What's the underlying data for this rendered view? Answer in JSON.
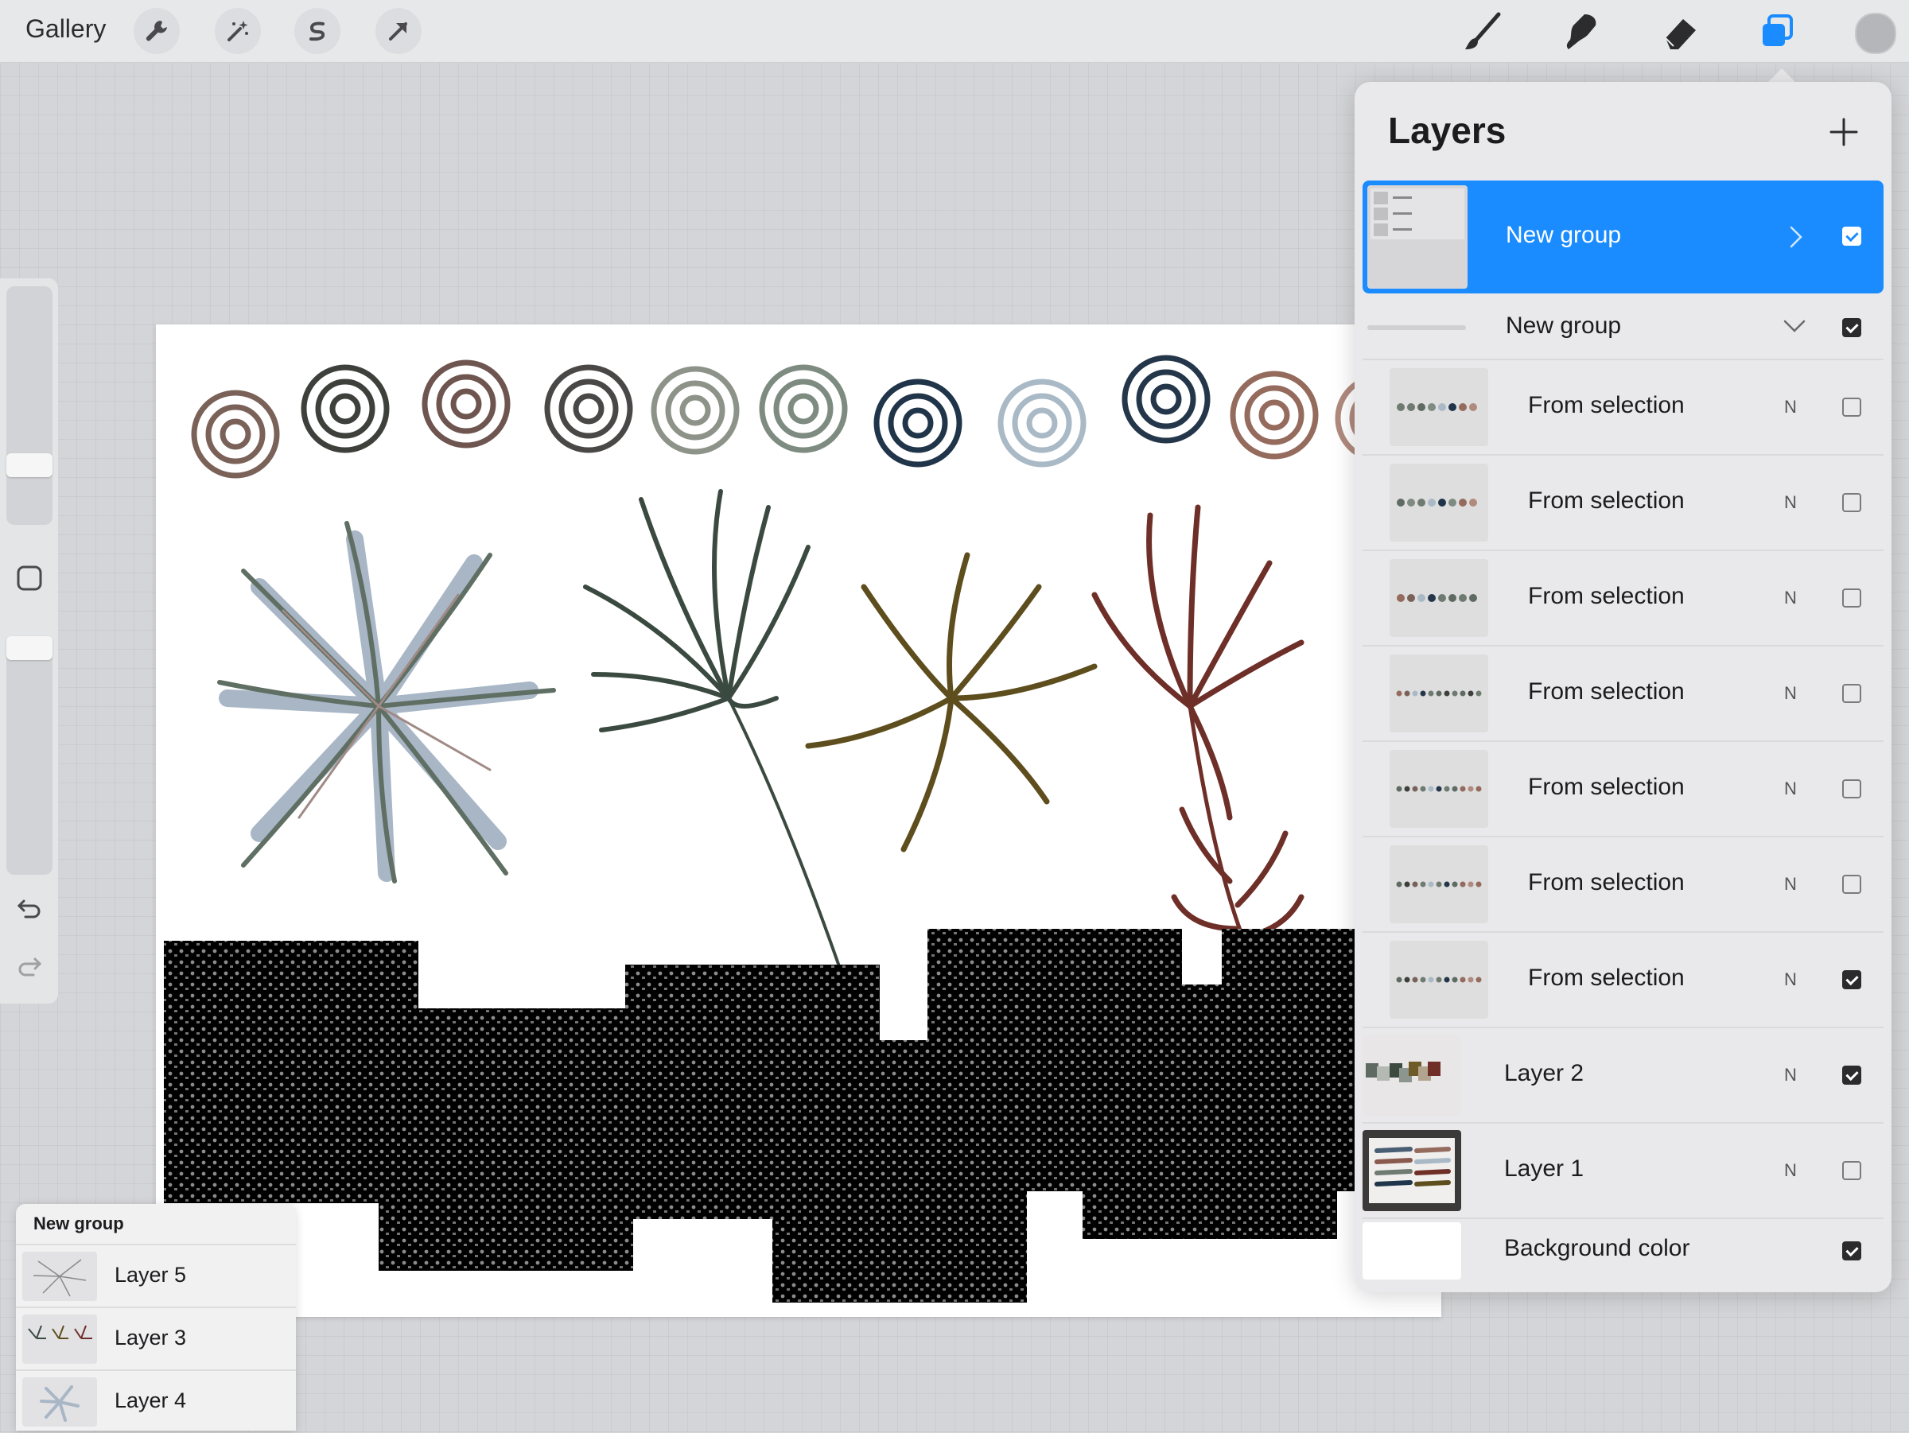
{
  "app": {
    "gallery_label": "Gallery",
    "toolbar_icons": [
      "wrench-icon",
      "magic-wand-icon",
      "selection-s-icon",
      "transform-arrow-icon"
    ],
    "tool_icons": [
      "brush-icon",
      "smudge-icon",
      "eraser-icon",
      "layers-icon"
    ],
    "accent_color": "#1a8cff"
  },
  "layers_panel": {
    "title": "Layers",
    "add_icon": "plus-icon",
    "rows": [
      {
        "name": "New group",
        "kind": "group",
        "selected": true,
        "expanded": false,
        "checked": true
      },
      {
        "name": "New group",
        "kind": "group",
        "selected": false,
        "expanded": true,
        "checked": true
      },
      {
        "name": "From selection",
        "blend": "N",
        "checked": false
      },
      {
        "name": "From selection",
        "blend": "N",
        "checked": false
      },
      {
        "name": "From selection",
        "blend": "N",
        "checked": false
      },
      {
        "name": "From selection",
        "blend": "N",
        "checked": false
      },
      {
        "name": "From selection",
        "blend": "N",
        "checked": false
      },
      {
        "name": "From selection",
        "blend": "N",
        "checked": false
      },
      {
        "name": "From selection",
        "blend": "N",
        "checked": true
      },
      {
        "name": "Layer 2",
        "blend": "N",
        "checked": true
      },
      {
        "name": "Layer 1",
        "blend": "N",
        "checked": false
      },
      {
        "name": "Background color",
        "checked": true
      }
    ]
  },
  "group_popup": {
    "title": "New group",
    "items": [
      {
        "name": "Layer 5"
      },
      {
        "name": "Layer 3"
      },
      {
        "name": "Layer 4"
      }
    ]
  }
}
